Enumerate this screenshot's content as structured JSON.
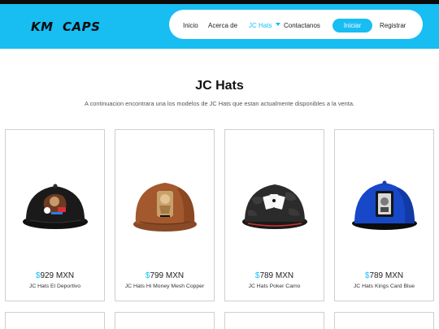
{
  "brand": {
    "logo": "KM  CAPS"
  },
  "nav": {
    "items": [
      {
        "label": "Inicio"
      },
      {
        "label": "Acerca de"
      },
      {
        "label": "JC Hats"
      },
      {
        "label": "Contactanos"
      }
    ],
    "login_label": "Iniciar",
    "register_label": "Registrar"
  },
  "page": {
    "title": "JC Hats",
    "subtitle": "A continuacion encontrara una los modelos de JC Hats que estan actualmente disponibles a la venta."
  },
  "products": [
    {
      "currency": "$",
      "price": "929 MXN",
      "name": "JC Hats El Deportivo"
    },
    {
      "currency": "$",
      "price": "799 MXN",
      "name": "JC Hats Hi Money Mesh Copper"
    },
    {
      "currency": "$",
      "price": "789 MXN",
      "name": "JC Hats Poker Camo"
    },
    {
      "currency": "$",
      "price": "789 MXN",
      "name": "JC Hats Kings Card Blue"
    }
  ],
  "colors": {
    "accent": "#18bdf2",
    "topbar": "#0a0a0a"
  }
}
